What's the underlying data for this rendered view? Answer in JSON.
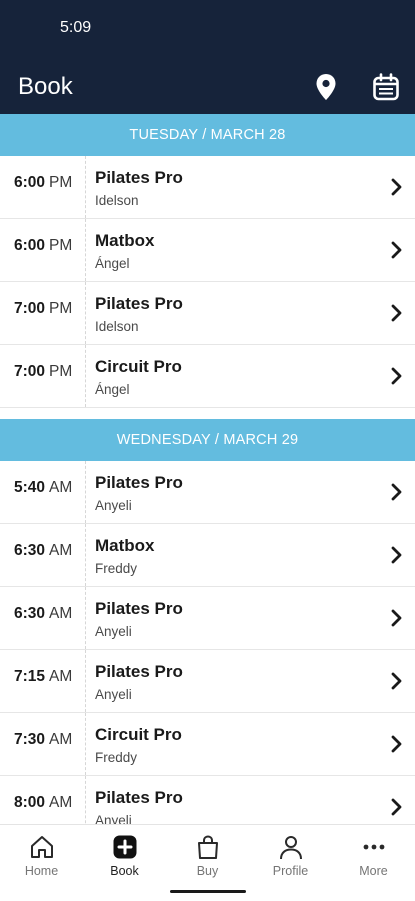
{
  "status_bar": {
    "time": "5:09"
  },
  "header": {
    "title": "Book",
    "icons": [
      "location-pin-icon",
      "calendar-icon"
    ]
  },
  "days": [
    {
      "label": "TUESDAY / MARCH 28",
      "classes": [
        {
          "time": "6:00",
          "ampm": "PM",
          "name": "Pilates Pro",
          "instructor": "Idelson"
        },
        {
          "time": "6:00",
          "ampm": "PM",
          "name": "Matbox",
          "instructor": "Ángel"
        },
        {
          "time": "7:00",
          "ampm": "PM",
          "name": "Pilates Pro",
          "instructor": "Idelson"
        },
        {
          "time": "7:00",
          "ampm": "PM",
          "name": "Circuit Pro",
          "instructor": "Ángel"
        }
      ]
    },
    {
      "label": "WEDNESDAY / MARCH 29",
      "classes": [
        {
          "time": "5:40",
          "ampm": "AM",
          "name": "Pilates Pro",
          "instructor": "Anyeli"
        },
        {
          "time": "6:30",
          "ampm": "AM",
          "name": "Matbox",
          "instructor": "Freddy"
        },
        {
          "time": "6:30",
          "ampm": "AM",
          "name": "Pilates Pro",
          "instructor": "Anyeli"
        },
        {
          "time": "7:15",
          "ampm": "AM",
          "name": "Pilates Pro",
          "instructor": "Anyeli"
        },
        {
          "time": "7:30",
          "ampm": "AM",
          "name": "Circuit Pro",
          "instructor": "Freddy"
        },
        {
          "time": "8:00",
          "ampm": "AM",
          "name": "Pilates Pro",
          "instructor": "Anyeli"
        }
      ]
    }
  ],
  "tabs": [
    {
      "label": "Home",
      "icon": "home-icon"
    },
    {
      "label": "Book",
      "icon": "book-plus-icon",
      "active": true
    },
    {
      "label": "Buy",
      "icon": "shopping-bag-icon"
    },
    {
      "label": "Profile",
      "icon": "profile-icon"
    },
    {
      "label": "More",
      "icon": "more-icon"
    }
  ],
  "colors": {
    "header_bg": "#16233a",
    "day_header_bg": "#63bcdf",
    "text": "#1a1a1a"
  }
}
